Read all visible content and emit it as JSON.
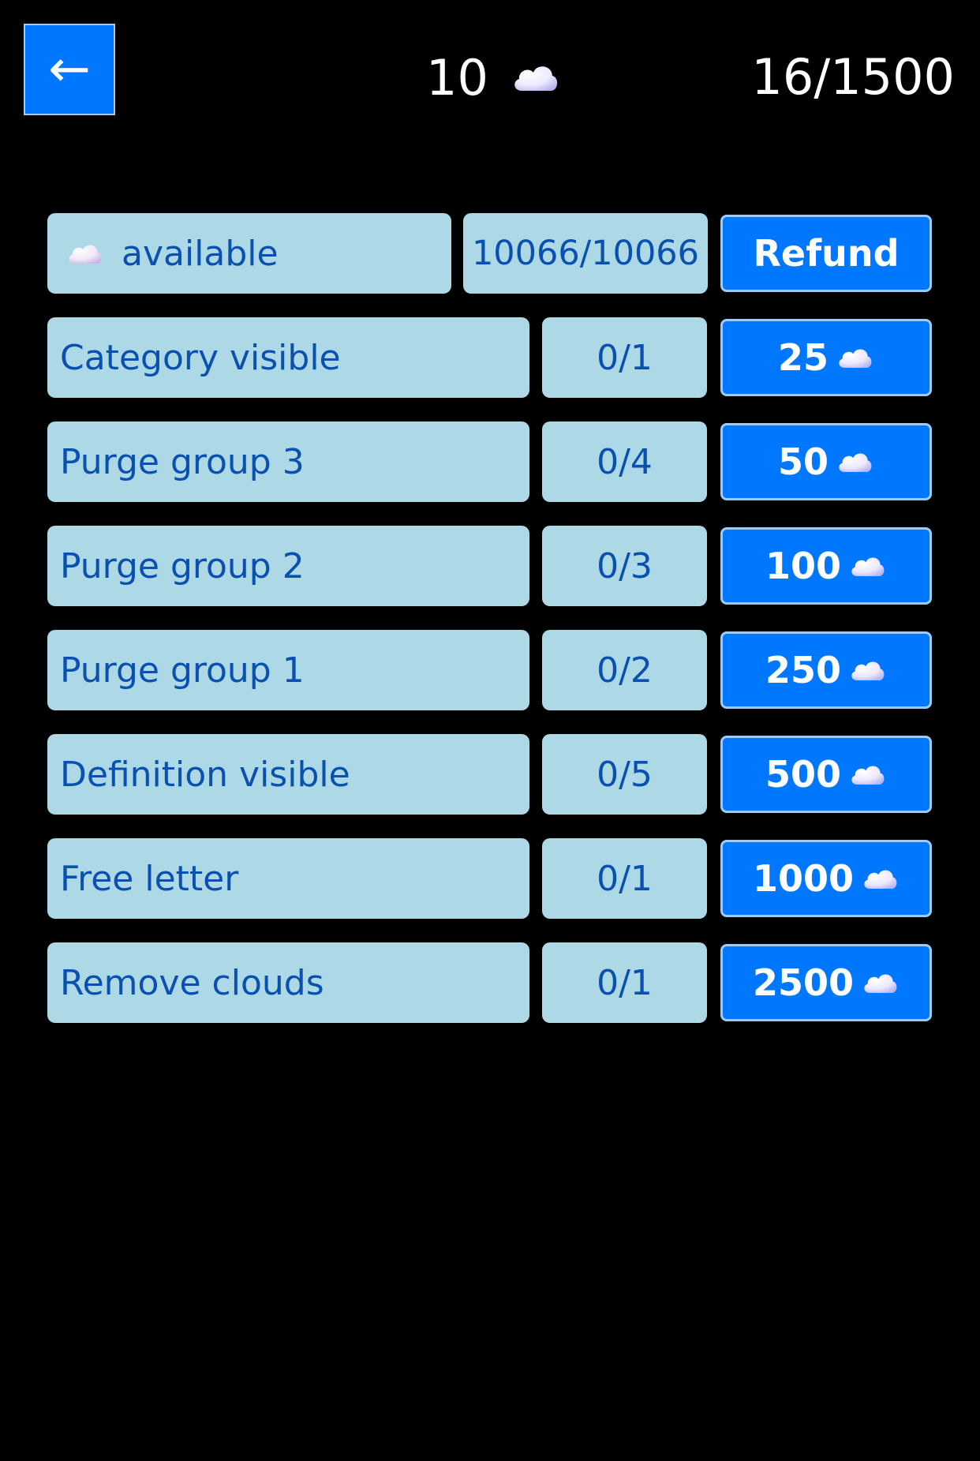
{
  "header": {
    "back_label": "←",
    "coins": "10",
    "progress": "16/1500"
  },
  "colors": {
    "background": "#000000",
    "accent": "#0077ff",
    "cell": "#add8e6",
    "cell_text": "#0a50b0"
  },
  "available_row": {
    "icon": "cloud-icon",
    "label": "available",
    "count": "10066/10066",
    "button": "Refund"
  },
  "items": [
    {
      "label": "Category visible",
      "count": "0/1",
      "price": "25"
    },
    {
      "label": "Purge group 3",
      "count": "0/4",
      "price": "50"
    },
    {
      "label": "Purge group 2",
      "count": "0/3",
      "price": "100"
    },
    {
      "label": "Purge group 1",
      "count": "0/2",
      "price": "250"
    },
    {
      "label": "Definition visible",
      "count": "0/5",
      "price": "500"
    },
    {
      "label": "Free letter",
      "count": "0/1",
      "price": "1000"
    },
    {
      "label": "Remove clouds",
      "count": "0/1",
      "price": "2500"
    }
  ]
}
